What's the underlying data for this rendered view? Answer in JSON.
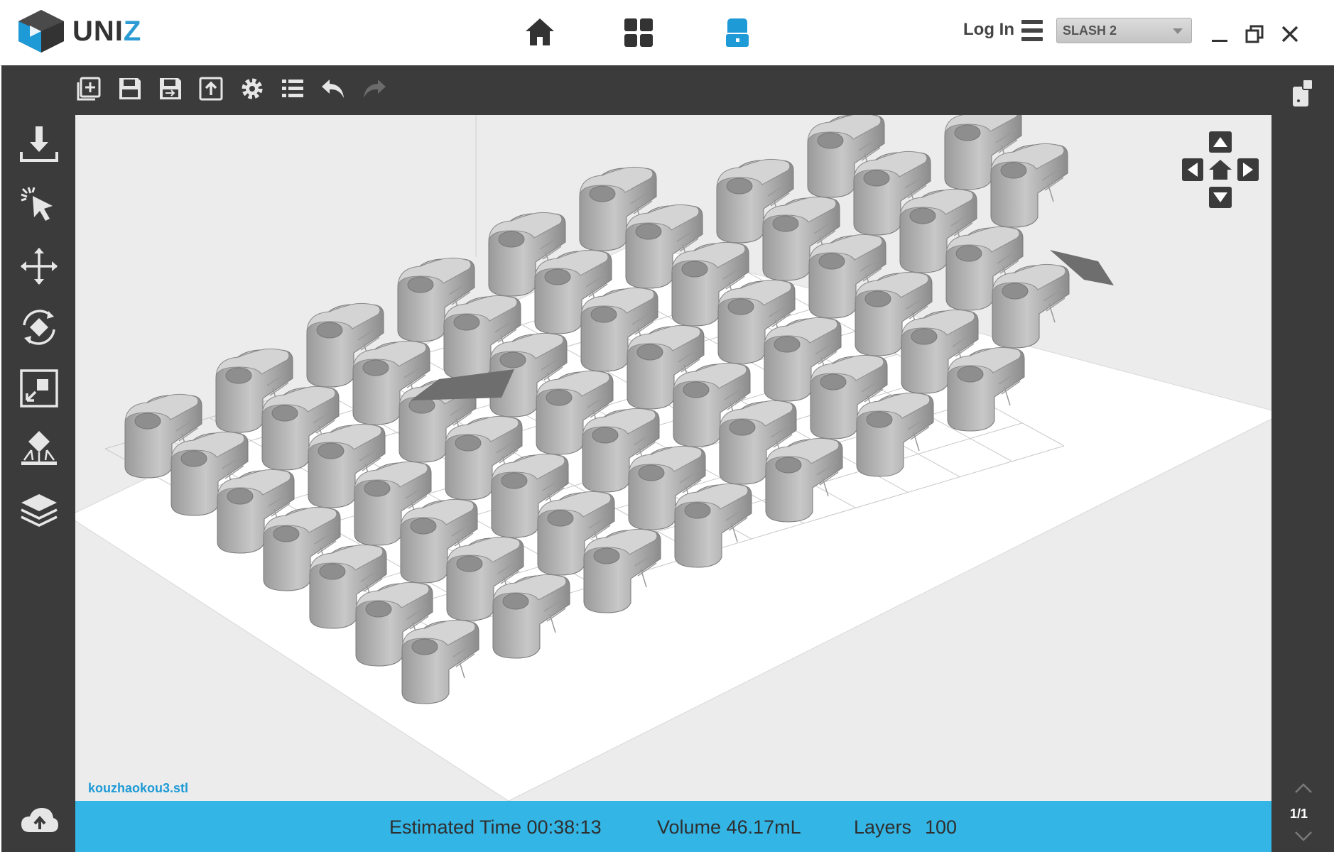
{
  "app": {
    "logo_text": "UNI",
    "logo_text_z": "Z",
    "nav": {
      "icons": [
        "home-icon",
        "grid-icon",
        "printer-icon"
      ],
      "active": "printer-icon"
    },
    "login_label": "Log In",
    "printer": {
      "selected": "SLASH 2"
    }
  },
  "colors": {
    "accent": "#33b5e5",
    "dark_panel": "#3b3b3b",
    "active_nav": "#1e9ad6",
    "filename": "#1e9ad6"
  },
  "toolbar": {
    "icons": [
      "add-model-icon",
      "save-icon",
      "save-as-icon",
      "export-icon",
      "settings-icon",
      "list-icon",
      "undo-icon",
      "redo-icon"
    ]
  },
  "sidebar": {
    "tools": [
      "import-icon",
      "select-icon",
      "move-icon",
      "rotate-icon",
      "scale-icon",
      "support-icon",
      "layers-icon"
    ],
    "bottom": "upload-icon"
  },
  "viewport": {
    "filename": "kouzhaokou3.stl",
    "grid": {
      "rows": 7,
      "cols": 13
    }
  },
  "status": {
    "estimated_time": "Estimated Time 00:38:13",
    "volume": "Volume 46.17mL",
    "layers_label": "Layers",
    "layers_value": "100"
  },
  "pager": {
    "label": "1/1"
  }
}
